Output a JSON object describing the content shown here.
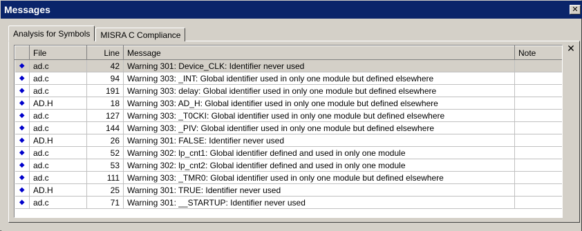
{
  "window": {
    "title": "Messages",
    "close_glyph": "✕"
  },
  "tabs": [
    {
      "label": "Analysis for Symbols",
      "active": true
    },
    {
      "label": "MISRA C Compliance",
      "active": false
    }
  ],
  "panel_close_glyph": "✕",
  "columns": {
    "icon": "",
    "file": "File",
    "line": "Line",
    "message": "Message",
    "note": "Note"
  },
  "rows": [
    {
      "file": "ad.c",
      "line": "42",
      "message": "Warning 301: Device_CLK: Identifier never used",
      "note": "",
      "selected": true
    },
    {
      "file": "ad.c",
      "line": "94",
      "message": "Warning 303: _INT: Global identifier used in only one module but defined elsewhere",
      "note": ""
    },
    {
      "file": "ad.c",
      "line": "191",
      "message": "Warning 303: delay: Global identifier used in only one module but defined elsewhere",
      "note": ""
    },
    {
      "file": "AD.H",
      "line": "18",
      "message": "Warning 303: AD_H: Global identifier used in only one module but defined elsewhere",
      "note": ""
    },
    {
      "file": "ad.c",
      "line": "127",
      "message": "Warning 303: _T0CKI: Global identifier used in only one module but defined elsewhere",
      "note": ""
    },
    {
      "file": "ad.c",
      "line": "144",
      "message": "Warning 303: _PIV: Global identifier used in only one module but defined elsewhere",
      "note": ""
    },
    {
      "file": "AD.H",
      "line": "26",
      "message": "Warning 301: FALSE: Identifier never used",
      "note": ""
    },
    {
      "file": "ad.c",
      "line": "52",
      "message": "Warning 302: lp_cnt1: Global identifier defined and used in only one module",
      "note": ""
    },
    {
      "file": "ad.c",
      "line": "53",
      "message": "Warning 302: lp_cnt2: Global identifier defined and used in only one module",
      "note": ""
    },
    {
      "file": "ad.c",
      "line": "111",
      "message": "Warning 303: _TMR0: Global identifier used in only one module but defined elsewhere",
      "note": ""
    },
    {
      "file": "AD.H",
      "line": "25",
      "message": "Warning 301: TRUE: Identifier never used",
      "note": ""
    },
    {
      "file": "ad.c",
      "line": "71",
      "message": "Warning 301: __STARTUP: Identifier never used",
      "note": ""
    }
  ],
  "row_icon": "diamond-icon",
  "row_icon_glyph": "◆",
  "colors": {
    "title_bar": "#0a246a",
    "icon": "#0000cc",
    "selected_row": "#d4d0c8"
  }
}
